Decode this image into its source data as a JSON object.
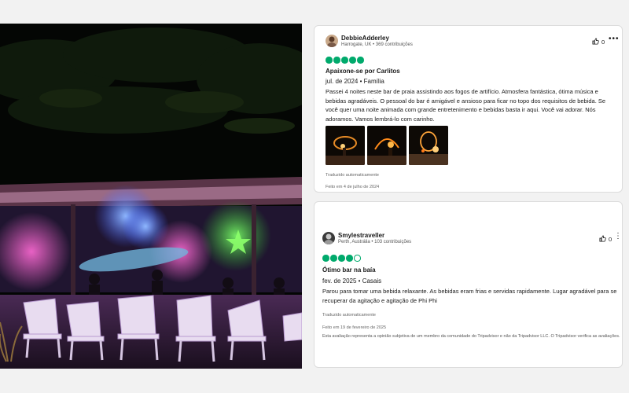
{
  "photo": {
    "icon": "beach-bar-night-photo"
  },
  "reviews": [
    {
      "author": "DebbieAdderley",
      "meta": "Harrogate, UK • 369 contribuições",
      "helpful_count": "0",
      "rating": 5,
      "title": "Apaixone-se por Carlitos",
      "date_line": "jul. de 2024 • Família",
      "body": "Passei 4 noites neste bar de praia assistindo aos fogos de artifício. Atmosfera fantástica, ótima música e bebidas agradáveis. O pessoal do bar é amigável e ansioso para ficar no topo dos requisitos de bebida. Se você quer uma noite animada com grande entretenimento e bebidas basta ir aqui. Você vai adorar. Nós adoramos. Vamos lembrá-lo com carinho.",
      "photos": [
        "fire-show-photo-1",
        "fire-show-photo-2",
        "fire-show-photo-3"
      ],
      "translated_note": "Traduzido automaticamente",
      "written_on": "Feito em 4 de julho de 2024"
    },
    {
      "author": "Smylestraveller",
      "meta": "Perth, Austrália • 103 contribuições",
      "helpful_count": "0",
      "rating": 4,
      "title": "Ótimo bar na baía",
      "date_line": "fev. de 2025 • Casais",
      "body": "Parou para tomar uma bebida relaxante. As bebidas eram frias e servidas rapidamente. Lugar agradável para se recuperar da agitação e agitação de Phi Phi",
      "translated_note": "Traduzido automaticamente",
      "written_on": "Feito em 19 de fevereiro de 2025",
      "disclaimer": "Esta avaliação representa a opinião subjetiva de um membro da comunidade do Tripadvisor e não da Tripadvisor LLC. O Tripadvisor verifica as avaliações."
    }
  ],
  "colors": {
    "bubble": "#00aa6c",
    "page_bg": "#f2f2f2",
    "card_border": "#dcdcdc"
  },
  "icons": {
    "helpful": "thumbs-up-icon",
    "more": "more-options-icon"
  }
}
